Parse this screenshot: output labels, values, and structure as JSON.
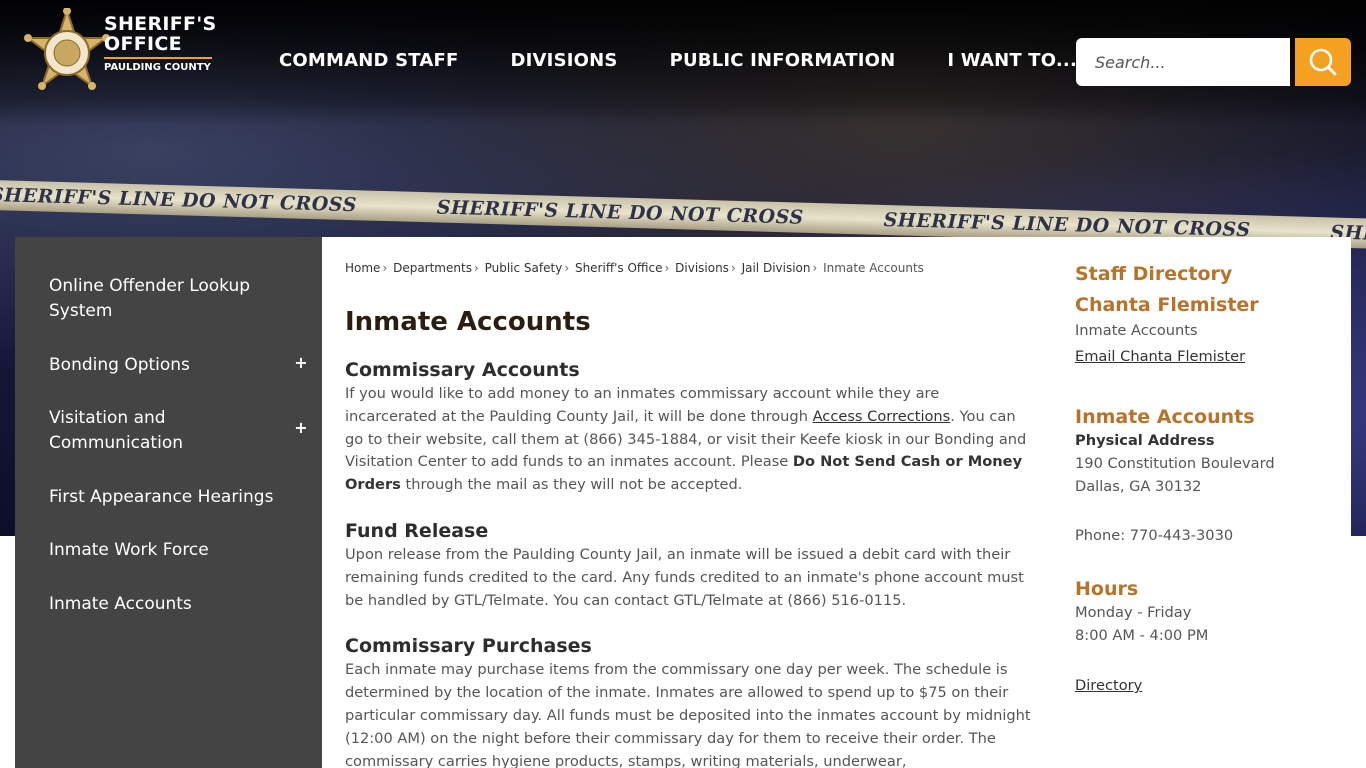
{
  "header": {
    "logo_title_line1": "SHERIFF'S",
    "logo_title_line2": "OFFICE",
    "logo_subtitle": "PAULDING COUNTY",
    "nav": [
      "COMMAND STAFF",
      "DIVISIONS",
      "PUBLIC INFORMATION",
      "I WANT TO..."
    ],
    "search_placeholder": "Search..."
  },
  "hero_tape_text": "SHERIFF'S LINE DO NOT CROSS",
  "sidebar": {
    "items": [
      {
        "label": "Online Offender Lookup System",
        "has_expand": false
      },
      {
        "label": "Bonding Options",
        "has_expand": true
      },
      {
        "label": "Visitation and Communication",
        "has_expand": true
      },
      {
        "label": "First Appearance Hearings",
        "has_expand": false
      },
      {
        "label": "Inmate Work Force",
        "has_expand": false
      },
      {
        "label": "Inmate Accounts",
        "has_expand": false
      }
    ],
    "expand_symbol": "+"
  },
  "breadcrumb": [
    "Home",
    "Departments",
    "Public Safety",
    "Sheriff's Office",
    "Divisions",
    "Jail Division",
    "Inmate Accounts"
  ],
  "breadcrumb_separator": "›",
  "page_title": "Inmate Accounts",
  "sections": {
    "commissary_accounts": {
      "heading": "Commissary Accounts",
      "text_1": "If you would like to add money to an inmates commissary account while they are incarcerated at the Paulding County Jail, it will be done through ",
      "link": "Access Corrections",
      "text_2": ".  You can go to their website, call them at (866) 345-1884, or visit their Keefe kiosk in our Bonding and Visitation Center to add funds to an inmates account.  Please ",
      "bold": "Do Not Send Cash or Money Orders",
      "text_3": " through the mail as they will not be accepted."
    },
    "fund_release": {
      "heading": "Fund Release",
      "text": "Upon release from the Paulding County Jail, an inmate will be issued a debit card with their remaining funds credited to the card.  Any funds credited to an inmate's phone account must be handled by GTL/Telmate. You can contact GTL/Telmate at (866) 516-0115."
    },
    "commissary_purchases": {
      "heading": "Commissary Purchases",
      "text": "Each inmate may purchase items from the commissary one day per week. The schedule is determined by the location of the inmate. Inmates are allowed to spend up to $75 on their particular commissary day.  All funds must be deposited into the inmates account by midnight (12:00 AM) on the night before their commissary day for them to receive their order. The commissary carries hygiene products, stamps, writing materials, underwear,"
    }
  },
  "contact": {
    "staff_heading": "Staff Directory",
    "name": "Chanta Flemister",
    "role": "Inmate Accounts",
    "email_link": "Email Chanta Flemister",
    "dept_heading": "Inmate Accounts",
    "address_label": "Physical Address",
    "address_line1": "190 Constitution Boulevard",
    "address_line2": "Dallas, GA 30132",
    "phone": "Phone: 770-443-3030",
    "hours_heading": "Hours",
    "hours_days": "Monday - Friday",
    "hours_time": "8:00 AM - 4:00 PM",
    "directory_link": "Directory"
  },
  "colors": {
    "accent": "#f4a021",
    "heading_brown": "#b8732a",
    "sidebar_bg": "#444444"
  }
}
